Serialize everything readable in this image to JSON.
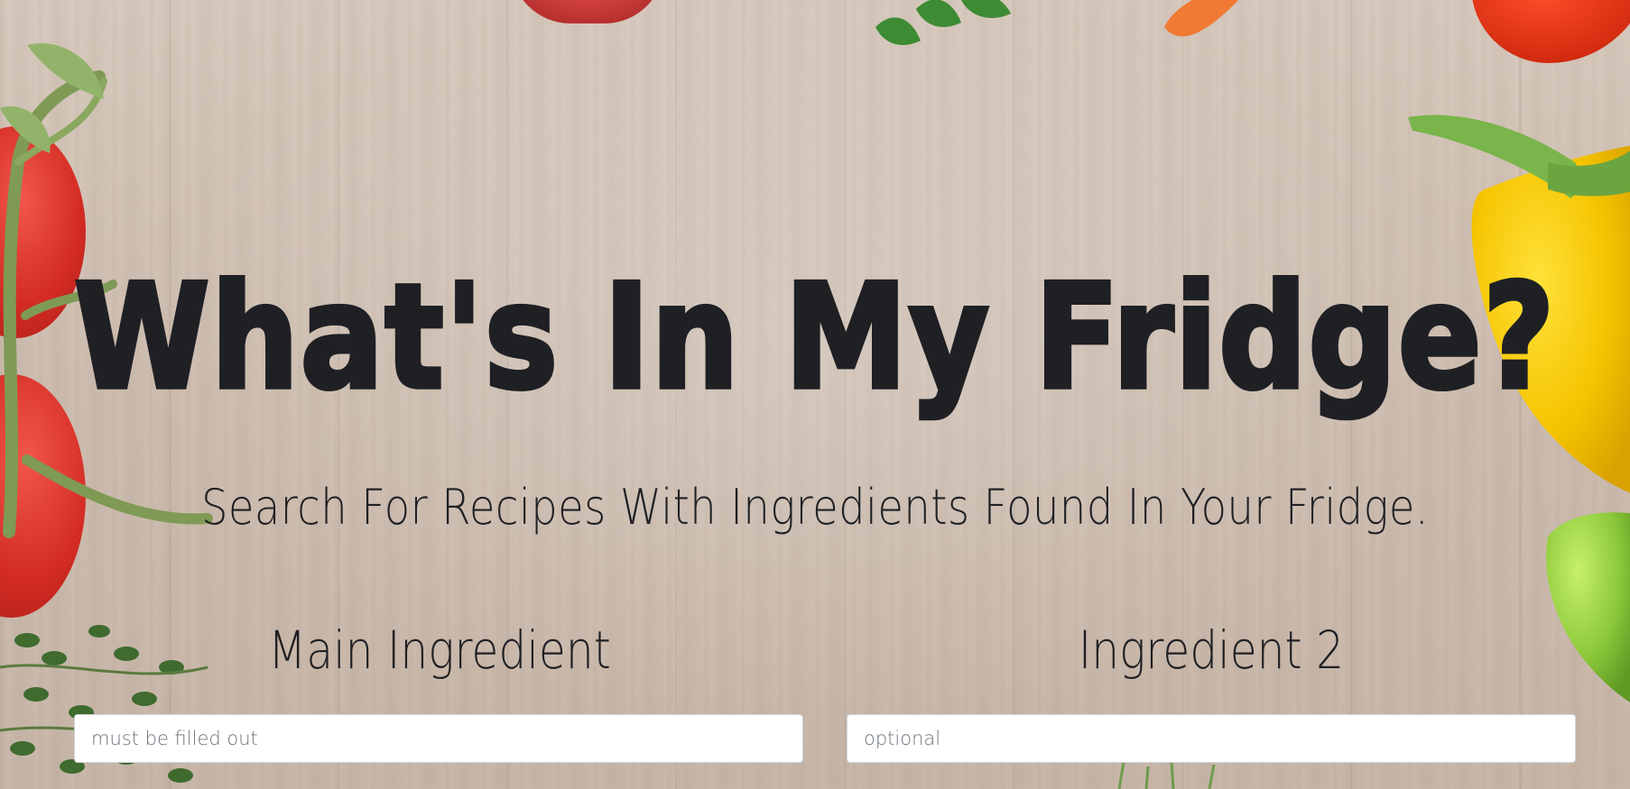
{
  "hero": {
    "title": "What's In My Fridge?",
    "subtitle": "Search For Recipes With Ingredients Found In Your Fridge."
  },
  "form": {
    "main_ingredient": {
      "label": "Main Ingredient",
      "placeholder": "must be filled out",
      "value": ""
    },
    "ingredient_2": {
      "label": "Ingredient 2",
      "placeholder": "optional",
      "value": ""
    }
  },
  "colors": {
    "text": "#1f2024",
    "background_wood": "#d7c9bd",
    "input_bg": "#ffffff",
    "input_border": "#ced4da"
  },
  "background": {
    "decorations": [
      "tomato-icon",
      "vine-icon",
      "herb-icon",
      "carrot-icon",
      "parsley-icon",
      "red-pepper-icon",
      "yellow-pepper-icon",
      "green-pepper-icon"
    ]
  }
}
